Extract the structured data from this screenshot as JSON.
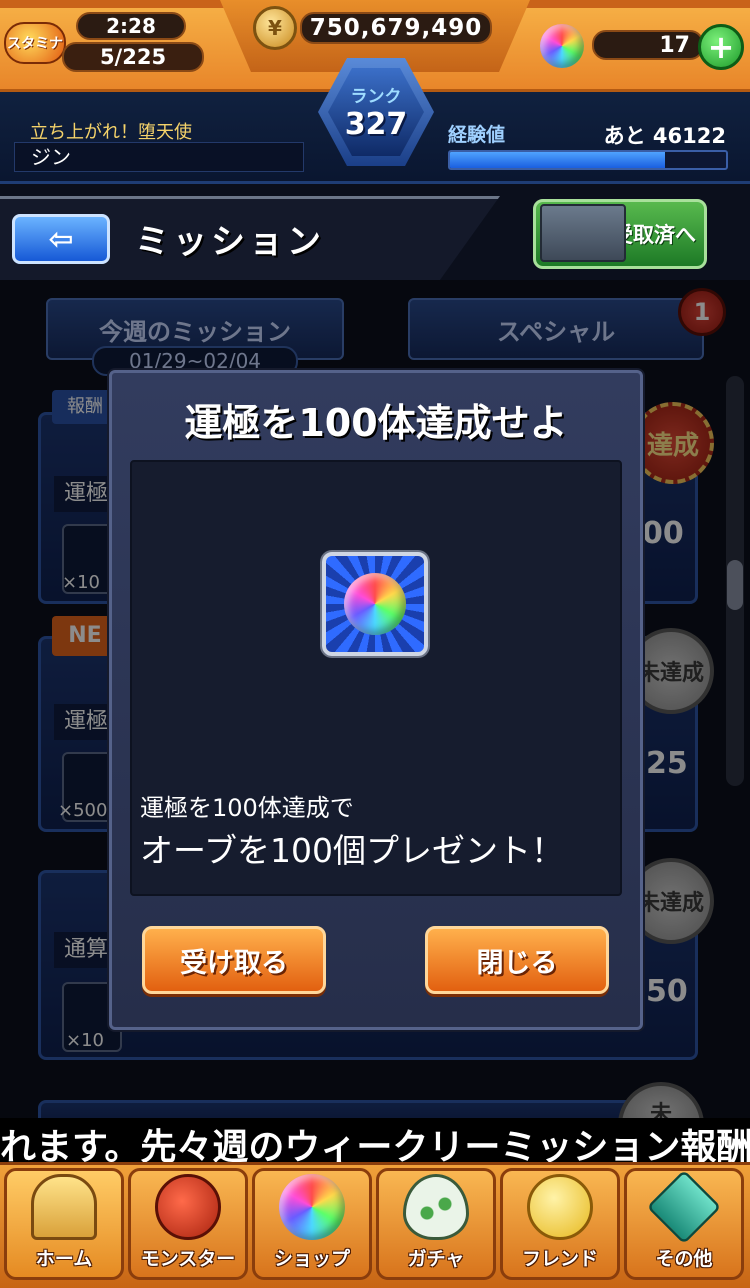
{
  "header": {
    "stamina_label": "スタミナ",
    "stamina_timer": "2:28",
    "stamina_value": "5/225",
    "gold": "750,679,490",
    "orb_count": "17",
    "rank_label": "ランク",
    "rank_value": "327",
    "title": "立ち上がれ！堕天使",
    "player_name": "ジン",
    "exp_label": "経験値",
    "exp_remaining": "あと 46122",
    "exp_progress": 0.78
  },
  "page": {
    "title": "ミッション",
    "received_button": "受取済へ"
  },
  "tabs": {
    "weekly": "今週のミッション",
    "weekly_dates": "01/29~02/04",
    "special": "スペシャル",
    "special_badge": "1"
  },
  "background_cards": [
    {
      "tag": "報酬",
      "title": "運極",
      "reward_qty": "×10",
      "progress": "00",
      "seal": "達成"
    },
    {
      "tag": "NE",
      "title": "運極",
      "reward_qty": "×500",
      "progress": "25",
      "seal": "未達成"
    },
    {
      "tag": "",
      "title": "通算",
      "reward_qty": "×10",
      "progress": "50",
      "seal": "未達成"
    },
    {
      "tag": "",
      "title": "",
      "reward_qty": "",
      "progress": "",
      "seal": "未"
    }
  ],
  "dialog": {
    "title": "運極を100体達成せよ",
    "description_line1": "運極を100体達成で",
    "description_line2": "オーブを100個プレゼント！",
    "receive_button": "受け取る",
    "close_button": "閉じる"
  },
  "ticker": "れます。先々週のウィークリーミッション報酬",
  "nav": [
    {
      "label": "ホーム",
      "icon": "home-gate-icon"
    },
    {
      "label": "モンスター",
      "icon": "monster-icon"
    },
    {
      "label": "ショップ",
      "icon": "orb-icon"
    },
    {
      "label": "ガチャ",
      "icon": "egg-icon"
    },
    {
      "label": "フレンド",
      "icon": "friend-balloon-icon"
    },
    {
      "label": "その他",
      "icon": "other-icon"
    }
  ],
  "colors": {
    "top_orange": "#f0a13a",
    "panel_navy": "#262e4a",
    "button_orange": "#e26010",
    "exp_blue": "#1a5fe0"
  }
}
